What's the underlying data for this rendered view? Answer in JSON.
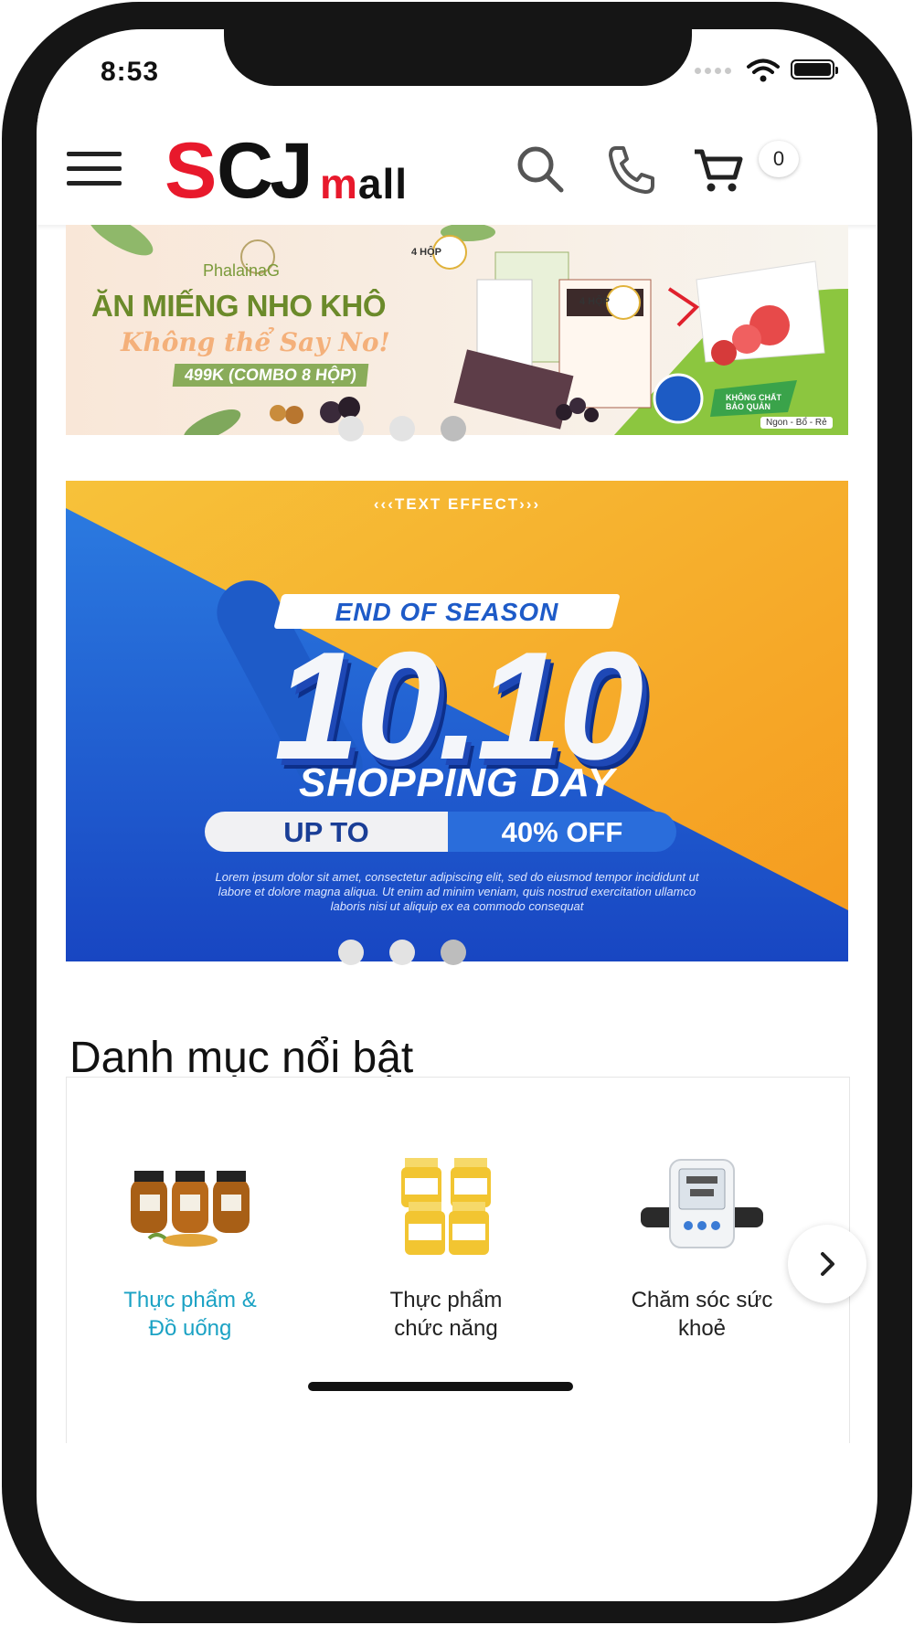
{
  "status_bar": {
    "time": "8:53"
  },
  "header": {
    "logo": {
      "s": "S",
      "c": "C",
      "j": "J",
      "mall_m": "m",
      "mall_rest": "all"
    },
    "cart_count": "0",
    "icons": [
      "menu-icon",
      "search-icon",
      "phone-icon",
      "cart-icon"
    ]
  },
  "banner1": {
    "brand": "PhalainaG",
    "headline": "ĂN MIẾNG NHO KHÔ",
    "subline": "Không thể Say No!",
    "price": "499K (COMBO 8 HỘP)",
    "tag": "Ngon - Bổ - Rẻ",
    "box_label_1": "4 HỘP",
    "box_label_2": "4 HỘP",
    "seal": "KHÔNG CHẤT BẢO QUẢN"
  },
  "banner2": {
    "effect": "‹‹‹TEXT EFFECT›››",
    "end_of_season": "END OF SEASON",
    "big": "10.10",
    "shopping_day": "SHOPPING DAY",
    "up_to": "UP TO",
    "off": "40% OFF",
    "lorem": "Lorem ipsum dolor sit amet, consectetur adipiscing elit, sed do eiusmod tempor incididunt ut labore et dolore magna aliqua. Ut enim ad minim veniam, quis nostrud exercitation ullamco laboris nisi ut aliquip ex ea commodo consequat"
  },
  "carousel": {
    "dot_count": 3,
    "active_index": 2
  },
  "featured": {
    "title": "Danh mục nổi bật",
    "categories": [
      {
        "line1": "Thực phẩm &",
        "line2": "Đồ uống",
        "active": true
      },
      {
        "line1": "Thực phẩm",
        "line2": "chức năng",
        "active": false
      },
      {
        "line1": "Chăm sóc sức",
        "line2": "khoẻ",
        "active": false
      }
    ]
  },
  "colors": {
    "brand_red": "#e8192c",
    "active_category": "#1ba2c4",
    "banner2_blue": "#1e5bc8",
    "banner2_yellow": "#f7b52a"
  }
}
